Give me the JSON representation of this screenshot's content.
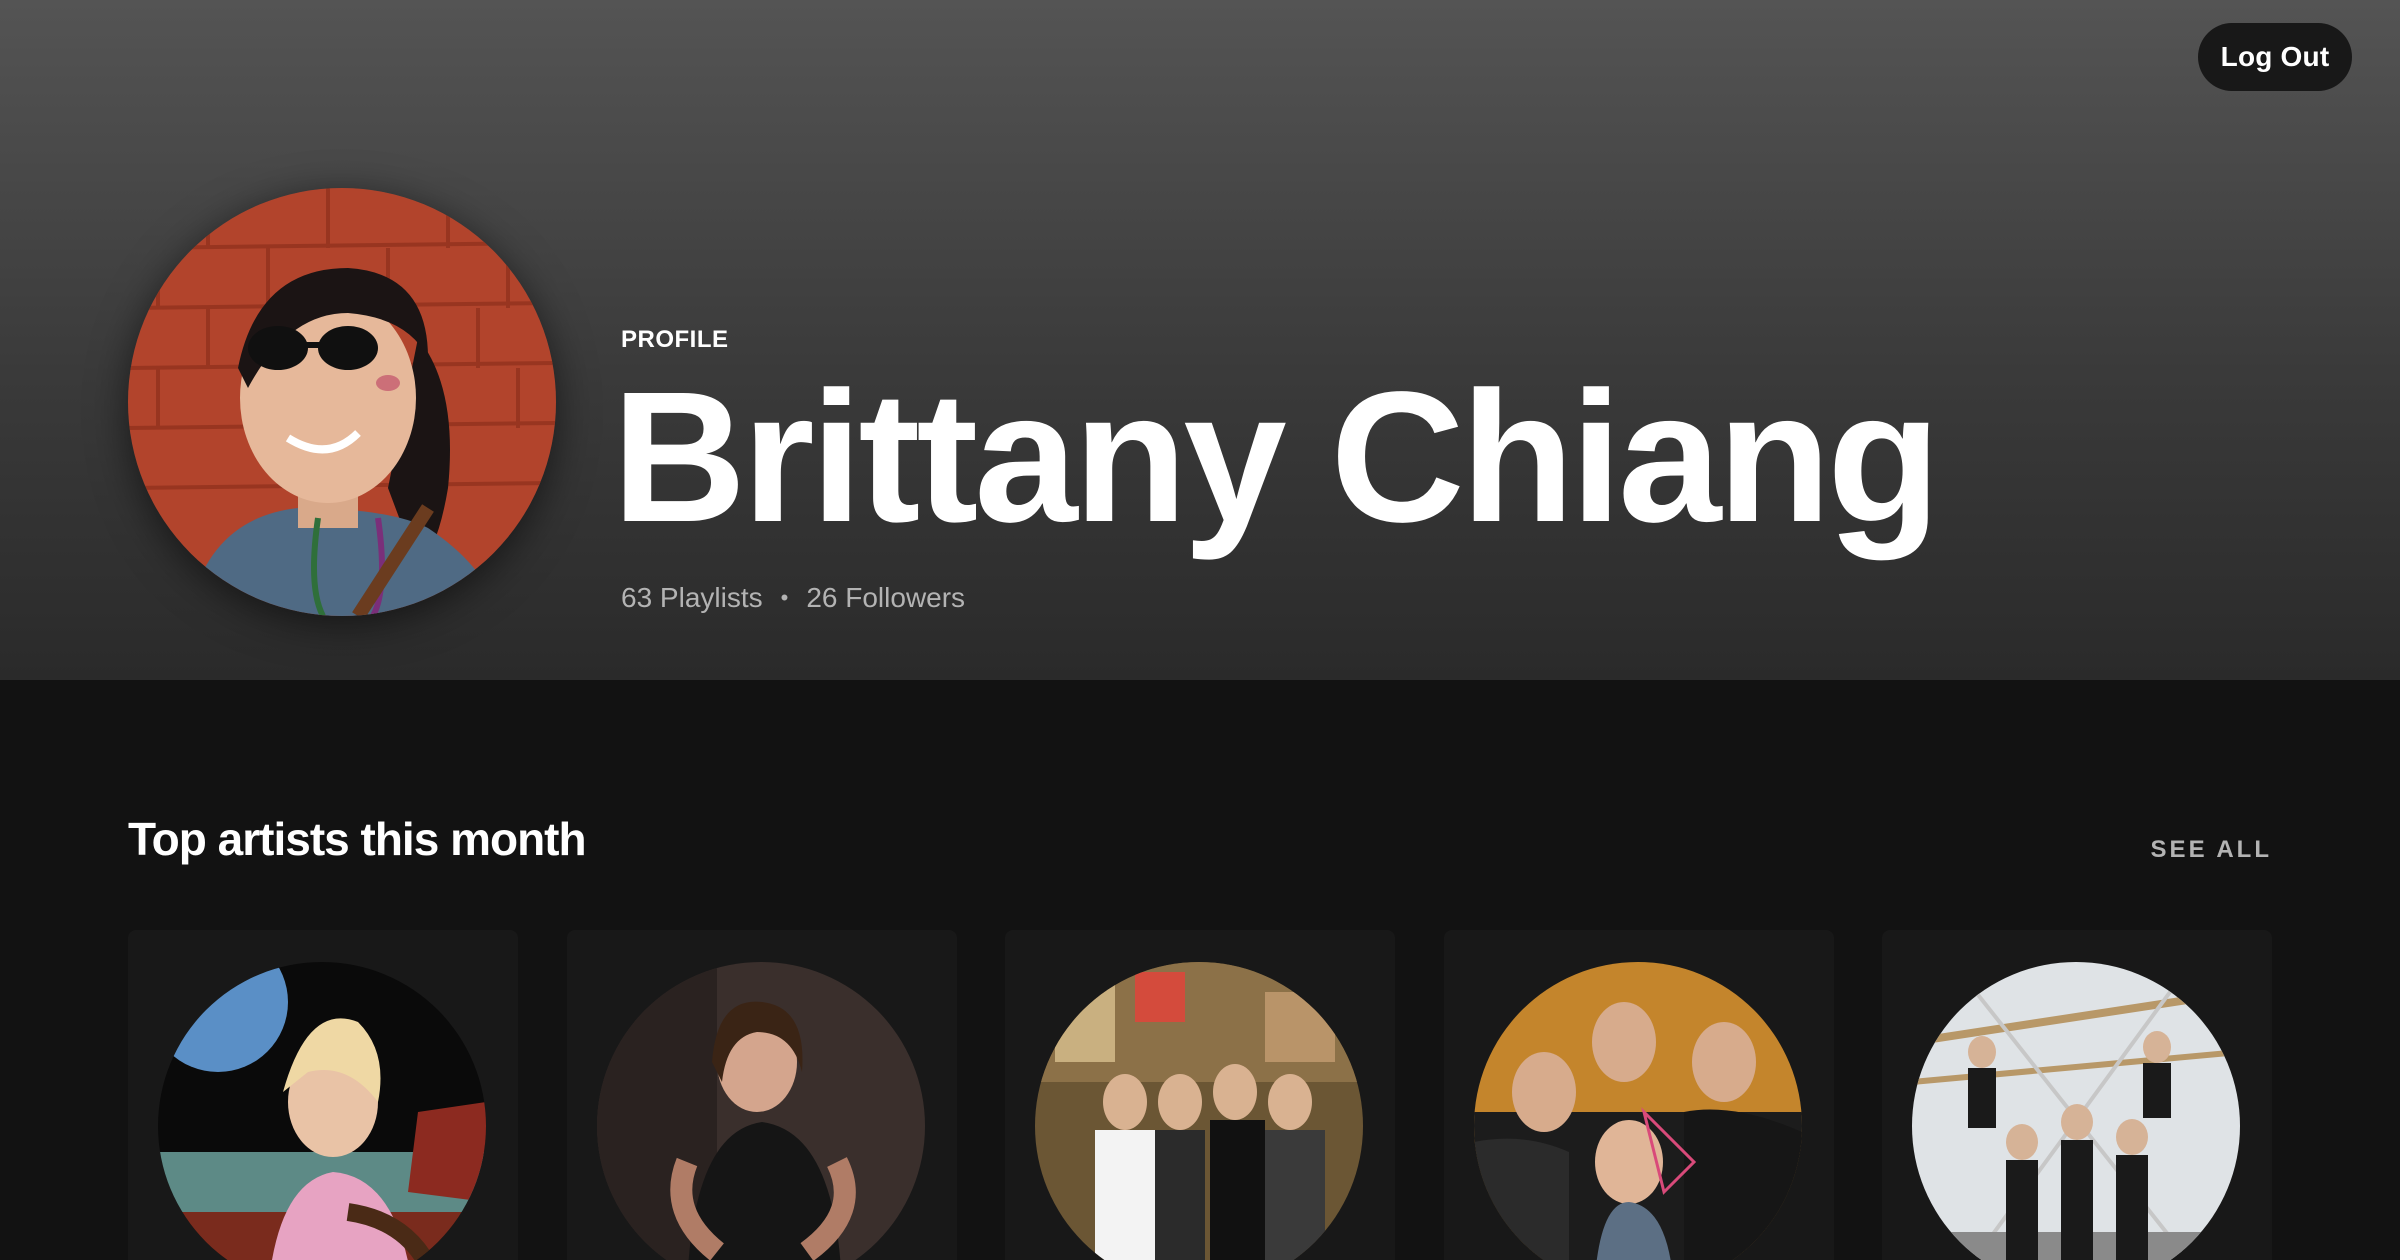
{
  "header": {
    "logout_label": "Log Out",
    "kicker": "PROFILE",
    "name": "Brittany Chiang",
    "playlists": "63 Playlists",
    "separator": "•",
    "followers": "26 Followers"
  },
  "top_artists": {
    "title": "Top artists this month",
    "see_all": "SEE ALL"
  },
  "colors": {
    "background": "#121212",
    "card": "#181818",
    "muted_text": "#b3b3b3"
  }
}
